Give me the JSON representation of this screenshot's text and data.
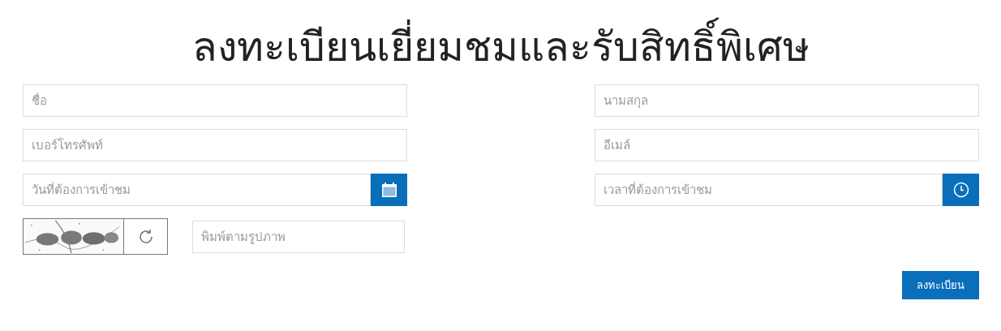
{
  "title": "ลงทะเบียนเยี่ยมชมและรับสิทธิ์พิเศษ",
  "fields": [
    {
      "kind": "text",
      "placeholder": "ชื่อ"
    },
    {
      "kind": "text",
      "placeholder": "นามสกุล"
    },
    {
      "kind": "text",
      "placeholder": "เบอร์โทรศัพท์"
    },
    {
      "kind": "text",
      "placeholder": "อีเมล์"
    },
    {
      "kind": "date",
      "placeholder": "วันที่ต้องการเข้าชม"
    },
    {
      "kind": "time",
      "placeholder": "เวลาที่ต้องการเข้าชม"
    }
  ],
  "captcha": {
    "placeholder": "พิมพ์ตามรูปภาพ"
  },
  "submit": "ลงทะเบียน"
}
